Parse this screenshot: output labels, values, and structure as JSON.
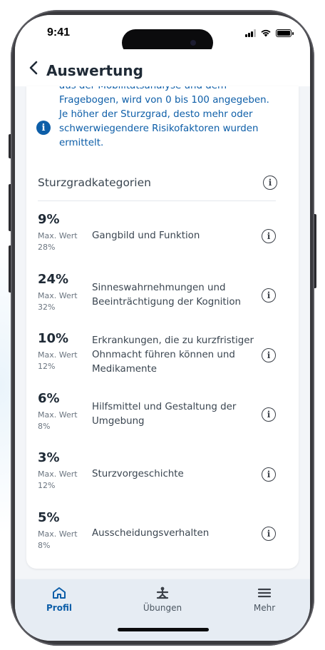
{
  "status_bar": {
    "time": "9:41"
  },
  "header": {
    "title": "Auswertung",
    "back_icon": "chevron-left-icon"
  },
  "info": {
    "icon": "info-filled-icon",
    "lines": [
      "aus der Mobilitätsanalyse und dem",
      "Fragebogen, wird von 0 bis 100 angegeben.",
      "Je höher der Sturzgrad, desto mehr oder",
      "schwerwiegendere Risikofaktoren wurden",
      "ermittelt."
    ],
    "color": "#0d5ea8"
  },
  "section": {
    "title": "Sturzgradkategorien",
    "info_icon": "info-outline-icon"
  },
  "categories": [
    {
      "percent": "9%",
      "max_label": "Max. Wert",
      "max_value": "28%",
      "label": "Gangbild und Funktion"
    },
    {
      "percent": "24%",
      "max_label": "Max. Wert",
      "max_value": "32%",
      "label": "Sinneswahrnehmungen und Beeinträchtigung der Kognition"
    },
    {
      "percent": "10%",
      "max_label": "Max. Wert",
      "max_value": "12%",
      "label": "Erkrankungen, die zu kurzfristiger Ohnmacht führen können und Medikamente"
    },
    {
      "percent": "6%",
      "max_label": "Max. Wert",
      "max_value": "8%",
      "label": "Hilfsmittel und Gestaltung der Umgebung"
    },
    {
      "percent": "3%",
      "max_label": "Max. Wert",
      "max_value": "12%",
      "label": "Sturzvorgeschichte"
    },
    {
      "percent": "5%",
      "max_label": "Max. Wert",
      "max_value": "8%",
      "label": "Ausscheidungsverhalten"
    }
  ],
  "tabbar": {
    "tabs": [
      {
        "label": "Profil",
        "icon": "home-icon",
        "active": true
      },
      {
        "label": "Übungen",
        "icon": "exercise-person-icon",
        "active": false
      },
      {
        "label": "Mehr",
        "icon": "menu-icon",
        "active": false
      }
    ],
    "accent": "#0d5ea8"
  }
}
